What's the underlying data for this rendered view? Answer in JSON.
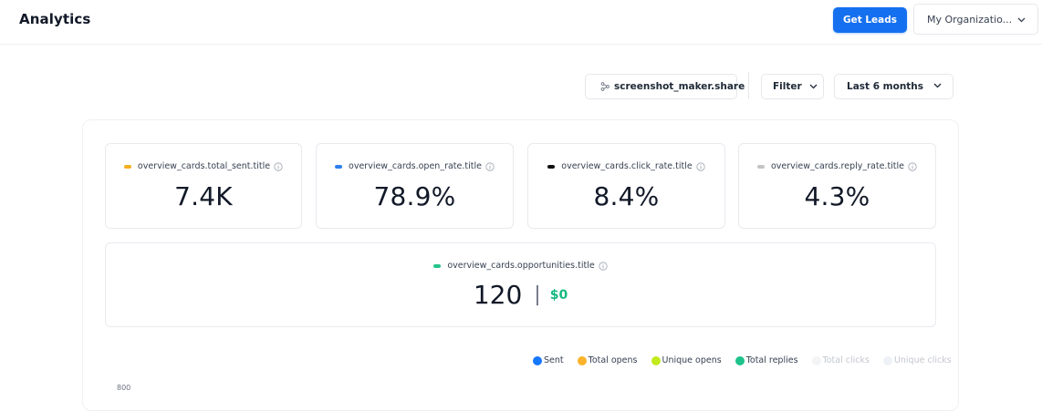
{
  "header": {
    "title": "Analytics",
    "primary_button": "Get Leads",
    "org_selector": "My Organizatio..."
  },
  "toolbar": {
    "share_label": "screenshot_maker.share",
    "filter_label": "Filter",
    "range_label": "Last 6 months"
  },
  "cards": [
    {
      "label": "overview_cards.total_sent.title",
      "value": "7.4K",
      "color": "#f5b020"
    },
    {
      "label": "overview_cards.open_rate.title",
      "value": "78.9%",
      "color": "#2f80ed"
    },
    {
      "label": "overview_cards.click_rate.title",
      "value": "8.4%",
      "color": "#111111"
    },
    {
      "label": "overview_cards.reply_rate.title",
      "value": "4.3%",
      "color": "#c4c4c4"
    }
  ],
  "opportunities": {
    "label": "overview_cards.opportunities.title",
    "count": "120",
    "separator": "|",
    "currency": "$",
    "amount": "0",
    "color": "#25c48a"
  },
  "legend": [
    {
      "label": "Sent",
      "color": "#1677ff",
      "muted": false
    },
    {
      "label": "Total opens",
      "color": "#fbb32c",
      "muted": false
    },
    {
      "label": "Unique opens",
      "color": "#c2ea1c",
      "muted": false
    },
    {
      "label": "Total replies",
      "color": "#1ec28b",
      "muted": false
    },
    {
      "label": "Total clicks",
      "color": "#f3f4f6",
      "muted": true
    },
    {
      "label": "Unique clicks",
      "color": "#eef1f6",
      "muted": true
    }
  ],
  "axis": {
    "partial_tick": "800"
  }
}
